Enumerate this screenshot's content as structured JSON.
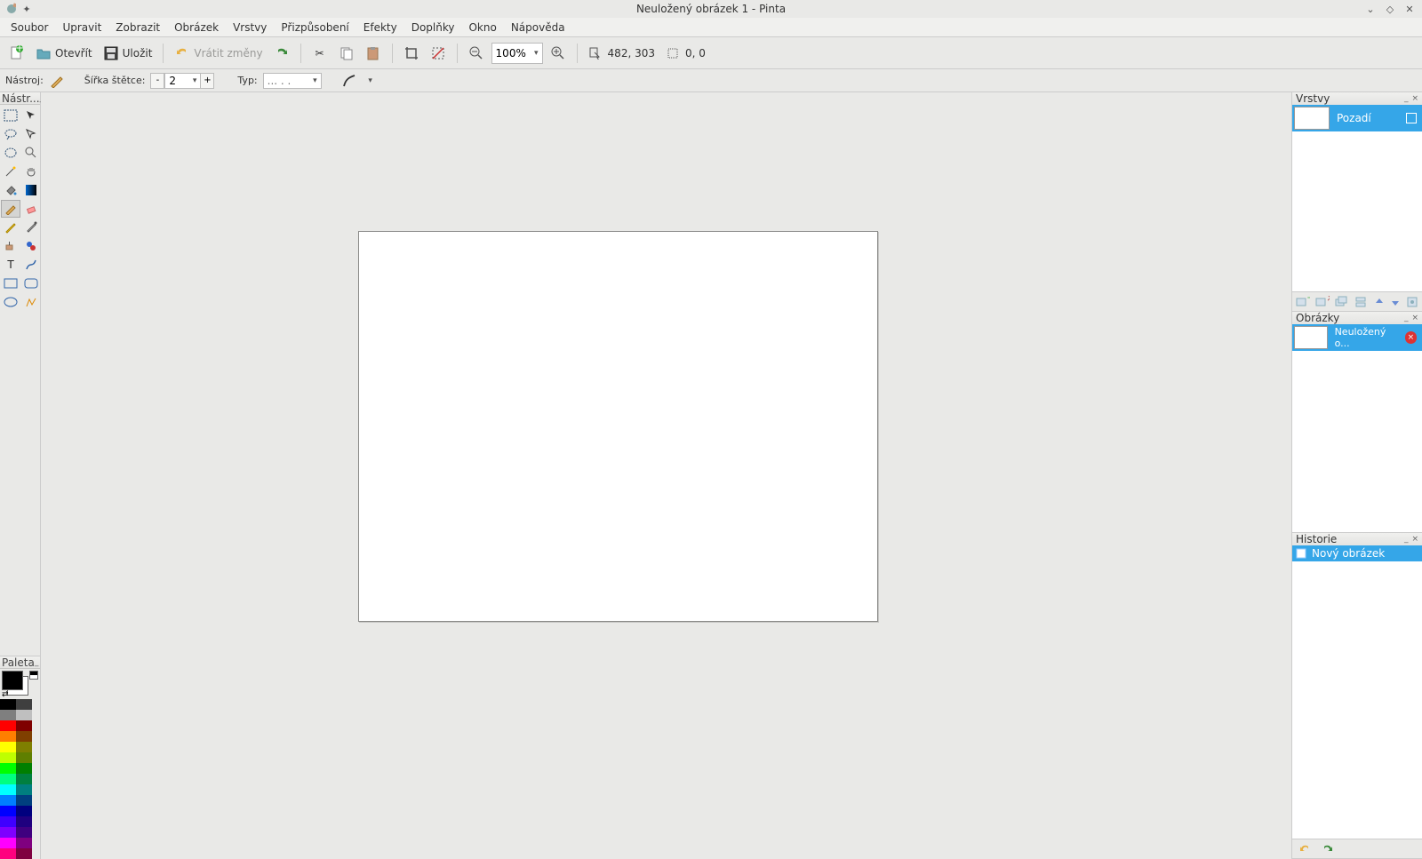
{
  "titlebar": {
    "title": "Neuložený obrázek 1 - Pinta"
  },
  "menu": {
    "soubor": "Soubor",
    "upravit": "Upravit",
    "zobrazit": "Zobrazit",
    "obrazek": "Obrázek",
    "vrstvy": "Vrstvy",
    "prizpusobeni": "Přizpůsobení",
    "efekty": "Efekty",
    "doplnky": "Doplňky",
    "okno": "Okno",
    "napoveda": "Nápověda"
  },
  "toolbar1": {
    "open": "Otevřít",
    "save": "Uložit",
    "undo": "Vrátit změny",
    "zoom": "100%",
    "cursor": "482, 303",
    "selection": "0, 0"
  },
  "toolbar2": {
    "tool_label": "Nástroj:",
    "brush_label": "Šířka štětce:",
    "brush_value": "2",
    "type_label": "Typ:",
    "type_value": "... . ."
  },
  "panels": {
    "tools_title": "Nástr...",
    "palette_title": "Paleta",
    "layers_title": "Vrstvy",
    "images_title": "Obrázky",
    "history_title": "Historie"
  },
  "layers": {
    "items": [
      {
        "name": "Pozadí"
      }
    ]
  },
  "images": {
    "items": [
      {
        "name": "Neuložený o..."
      }
    ]
  },
  "history": {
    "items": [
      {
        "name": "Nový obrázek"
      }
    ]
  },
  "palette_colors": [
    "#000000",
    "#3f3f3f",
    "#7f7f7f",
    "#bfbfbf",
    "#ff0000",
    "#7f0000",
    "#ff7f00",
    "#7f3f00",
    "#ffff00",
    "#7f7f00",
    "#bfff00",
    "#5f7f00",
    "#00ff00",
    "#007f00",
    "#00ff7f",
    "#007f3f",
    "#00ffff",
    "#007f7f",
    "#007fff",
    "#003f7f",
    "#0000ff",
    "#00007f",
    "#3f00ff",
    "#1f007f",
    "#7f00ff",
    "#3f007f",
    "#ff00ff",
    "#7f007f",
    "#ff007f",
    "#7f003f"
  ]
}
